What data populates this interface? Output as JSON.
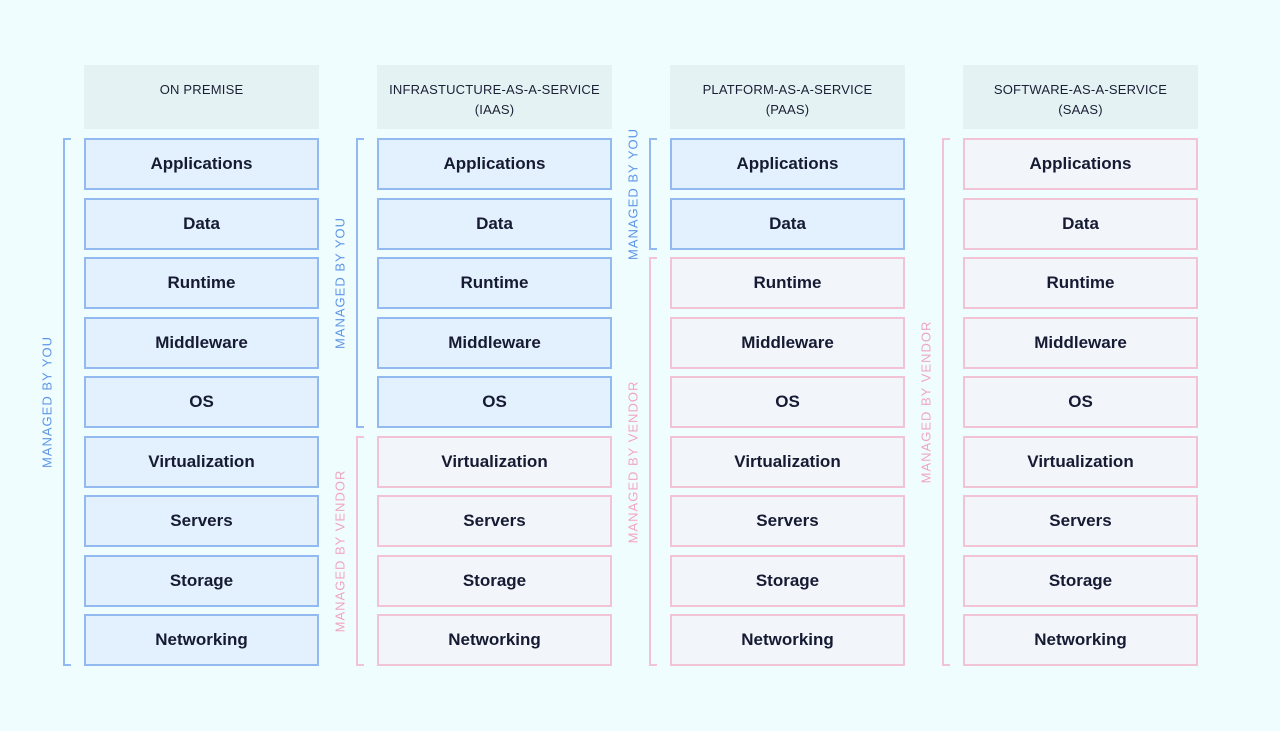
{
  "labels": {
    "you": "MANAGED BY YOU",
    "vendor": "MANAGED BY VENDOR"
  },
  "colors": {
    "background": "#f0fdfe",
    "you_fill": "#e2f1fd",
    "you_border": "#93baf0",
    "you_text": "#5d95e6",
    "vendor_fill": "#f2f5fa",
    "vendor_border": "#f2c3d5",
    "vendor_text": "#f0a5c0",
    "header_fill": "#e5f2f3"
  },
  "layers": [
    "Applications",
    "Data",
    "Runtime",
    "Middleware",
    "OS",
    "Virtualization",
    "Servers",
    "Storage",
    "Networking"
  ],
  "columns": [
    {
      "title": "ON PREMISE",
      "subtitle": "",
      "managed_by_you_count": 9
    },
    {
      "title": "INFRASTUCTURE-AS-A-SERVICE",
      "subtitle": "(IAAS)",
      "managed_by_you_count": 5
    },
    {
      "title": "PLATFORM-AS-A-SERVICE",
      "subtitle": "(PAAS)",
      "managed_by_you_count": 2
    },
    {
      "title": "SOFTWARE-AS-A-SERVICE",
      "subtitle": "(SAAS)",
      "managed_by_you_count": 0
    }
  ]
}
